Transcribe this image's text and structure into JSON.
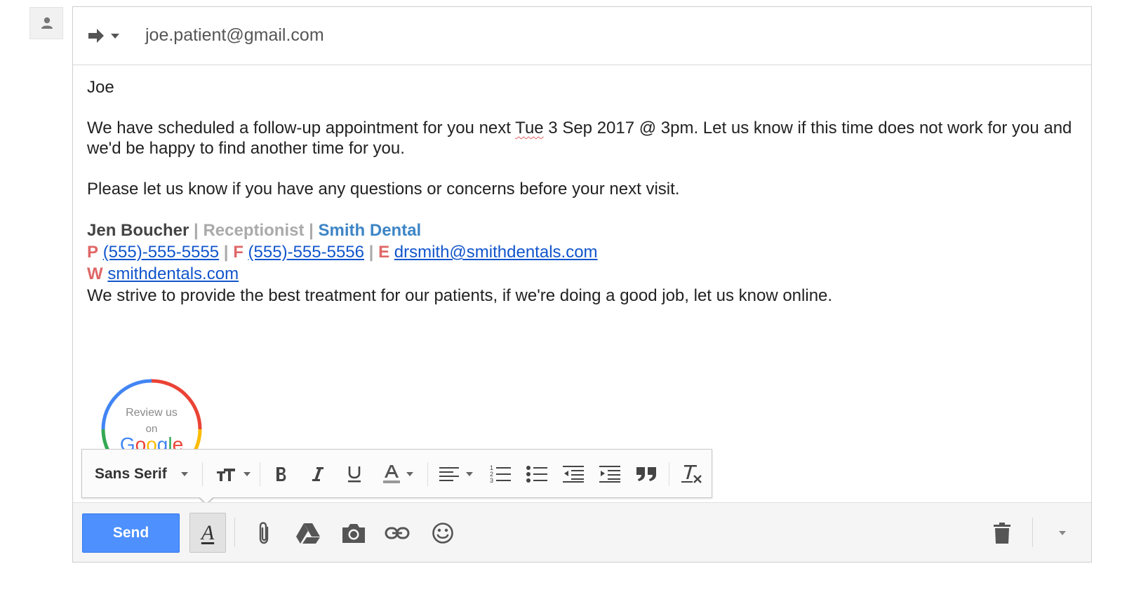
{
  "compose": {
    "reply_type_icon": "reply-arrow-icon",
    "recipient": "joe.patient@gmail.com"
  },
  "message": {
    "greeting": "Joe",
    "para1_before": "We have scheduled a follow-up appointment for you next ",
    "para1_flagged": "Tue",
    "para1_after": " 3 Sep 2017 @ 3pm. Let us know if this time does not work for you and we'd be happy to find another time for you.",
    "para2": "Please let us know if you have any questions or concerns before your next visit."
  },
  "signature": {
    "name": "Jen Boucher",
    "sep": " | ",
    "role": "Receptionist",
    "company": "Smith Dental",
    "phone_key": "P",
    "phone": "(555)-555-5555",
    "fax_key": "F",
    "fax": "(555)-555-5556",
    "email_key": "E",
    "email": "drsmith@smithdentals.com",
    "web_key": "W",
    "web": "smithdentals.com",
    "tagline": "We strive to provide the best treatment for our patients, if we're doing a good job, let us know online.",
    "badge": {
      "line1": "Review us",
      "line2": "on",
      "brand": "Google",
      "colors": [
        "#4285f4",
        "#ea4335",
        "#fbbc05",
        "#34a853"
      ]
    }
  },
  "formatting": {
    "font": "Sans Serif",
    "icons": [
      "text-size-icon",
      "bold-icon",
      "italic-icon",
      "underline-icon",
      "text-color-icon",
      "align-icon",
      "numbered-list-icon",
      "bulleted-list-icon",
      "indent-less-icon",
      "indent-more-icon",
      "quote-icon",
      "remove-formatting-icon"
    ]
  },
  "bottom": {
    "send_label": "Send",
    "formatting_toggle_glyph": "A",
    "icons": [
      "attach-icon",
      "drive-icon",
      "camera-icon",
      "link-icon",
      "emoji-icon",
      "trash-icon",
      "more-options-icon"
    ],
    "send_color": "#4d90fe"
  }
}
